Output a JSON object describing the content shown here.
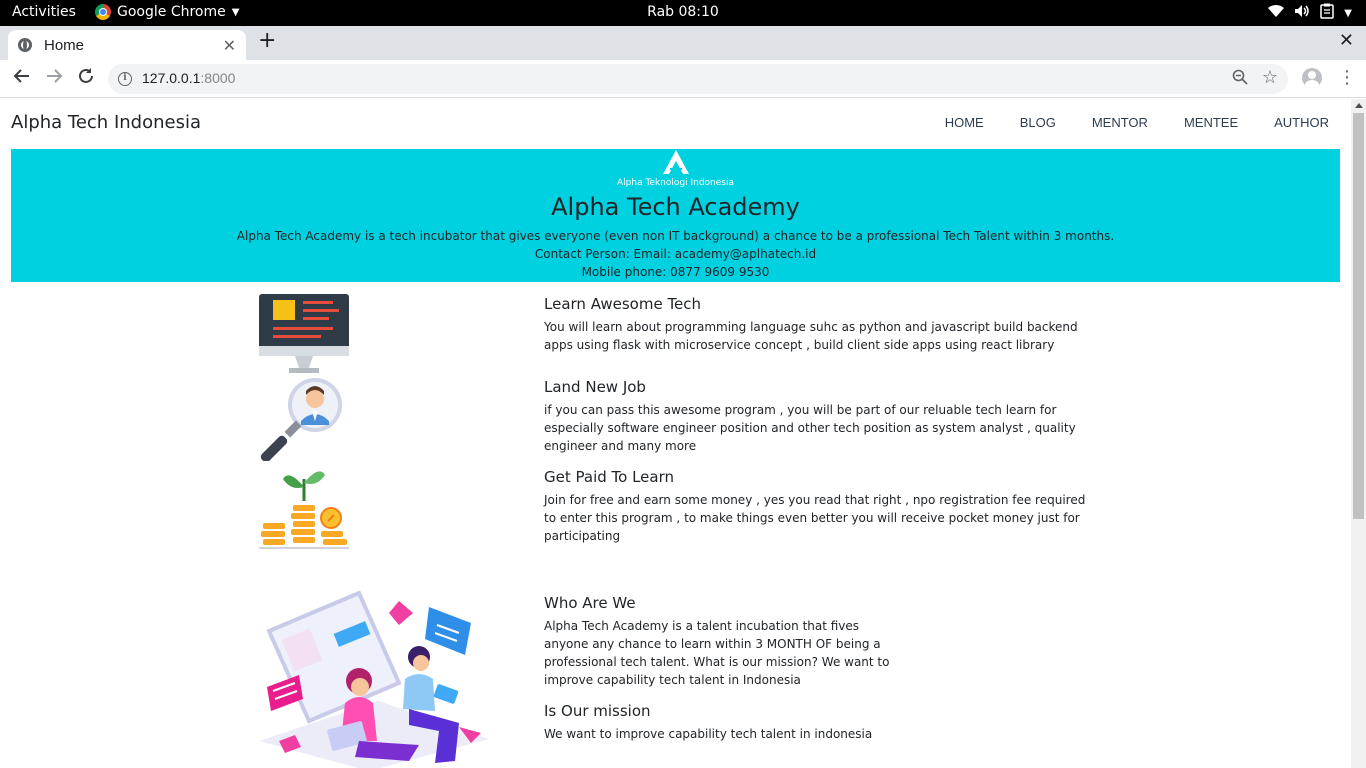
{
  "system_bar": {
    "activities": "Activities",
    "app_name": "Google Chrome",
    "clock": "Rab 08:10"
  },
  "browser": {
    "tab_title": "Home",
    "url_host": "127.0.0.1",
    "url_port": ":8000"
  },
  "site": {
    "brand": "Alpha Tech Indonesia",
    "nav": [
      "HOME",
      "BLOG",
      "MENTOR",
      "MENTEE",
      "AUTHOR"
    ]
  },
  "hero": {
    "logo_text": "Alpha Teknologi Indonesia",
    "title": "Alpha Tech Academy",
    "description": "Alpha Tech Academy is a tech incubator that gives everyone (even non IT background) a chance to be a professional Tech Talent within 3 months.",
    "contact": "Contact Person: Email: academy@aplhatech.id",
    "phone": "Mobile phone: 0877 9609 9530",
    "background_color": "#00d1e0"
  },
  "features": [
    {
      "title": "Learn Awesome Tech",
      "text": "You will learn about programming language suhc as python and javascript build backend apps using flask with microservice concept , build client side apps using react library",
      "icon": "monitor-code-icon"
    },
    {
      "title": "Land New Job",
      "text": "if you can pass this awesome program , you will be part of our reluable tech learn for especially software engineer position and other tech position as system analyst , quality engineer and many more",
      "icon": "magnifier-person-icon"
    },
    {
      "title": "Get Paid To Learn",
      "text": "Join for free and earn some money , yes you read that right , npo registration fee required to enter this program , to make things even better you will receive pocket money just for participating",
      "icon": "coins-plant-icon"
    }
  ],
  "about": {
    "who_title": "Who Are We",
    "who_text": "Alpha Tech Academy is a talent incubation that fives anyone any chance to learn within 3 MONTH OF being a professional tech talent. What is our mission? We want to improve capability tech talent in Indonesia",
    "mission_title": "Is Our mission",
    "mission_text": "We want to improve capability tech talent in indonesia",
    "illustration": "team-working-illustration"
  }
}
